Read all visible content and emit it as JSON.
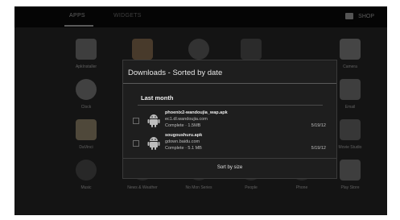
{
  "launcher": {
    "tabs": [
      {
        "label": "APPS"
      },
      {
        "label": "WIDGETS"
      }
    ],
    "shop_label": "SHOP",
    "apps_row1": [
      "ApkInstaller",
      "",
      "",
      "",
      "Camera"
    ],
    "apps_row2": [
      "Clock",
      "",
      "",
      "",
      "Email"
    ],
    "apps_row3": [
      "DaVinci",
      "",
      "",
      "",
      "Movie Studio"
    ],
    "apps_row4": [
      "Music",
      "News & Weather",
      "No Mon Series",
      "People",
      "Phone",
      "Play Store"
    ]
  },
  "dialog": {
    "title": "Downloads - Sorted by date",
    "section": "Last month",
    "items": [
      {
        "file": "phoenix2-wandoujia_wap.apk",
        "host": "ec1.dl.wandoujia.com",
        "status": "Complete · 1.5MB",
        "date": "5/19/12"
      },
      {
        "file": "sougoushuru.apk",
        "host": "gdown.baidu.com",
        "status": "Complete · 5.1 MB",
        "date": "5/19/12"
      }
    ],
    "sort_button": "Sort by size"
  }
}
